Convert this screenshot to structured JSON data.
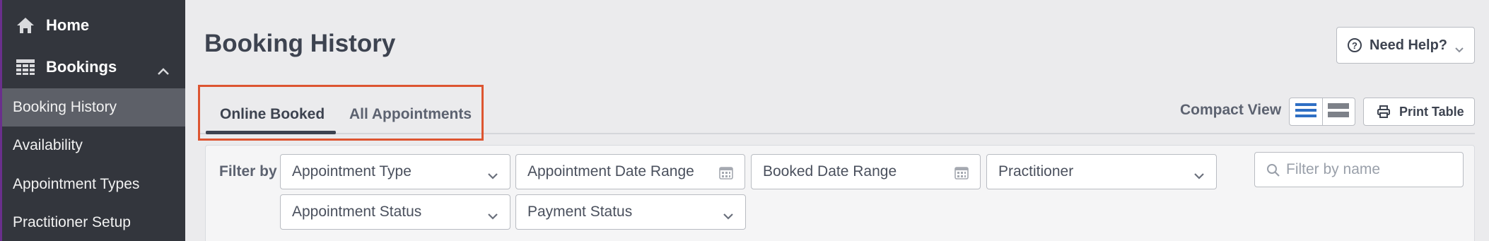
{
  "sidebar": {
    "home_label": "Home",
    "bookings_label": "Bookings",
    "sub_items": [
      {
        "label": "Booking History"
      },
      {
        "label": "Availability"
      },
      {
        "label": "Appointment Types"
      },
      {
        "label": "Practitioner Setup"
      }
    ]
  },
  "page": {
    "title": "Booking History",
    "help_label": "Need Help?"
  },
  "tabs": [
    {
      "label": "Online Booked"
    },
    {
      "label": "All Appointments"
    }
  ],
  "toolbar": {
    "compact_label": "Compact View",
    "print_label": "Print Table"
  },
  "filters": {
    "label": "Filter by",
    "appointment_type": "Appointment Type",
    "appointment_date_range": "Appointment Date Range",
    "booked_date_range": "Booked Date Range",
    "practitioner": "Practitioner",
    "appointment_status": "Appointment Status",
    "payment_status": "Payment Status",
    "search_placeholder": "Filter by name"
  },
  "colors": {
    "accent_blue": "#2f6fc4",
    "highlight_red": "#dd5531",
    "sidebar_bg": "#33363d"
  }
}
